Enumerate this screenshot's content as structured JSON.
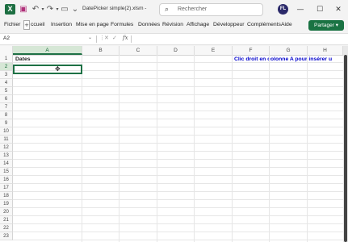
{
  "titlebar": {
    "logo_letter": "X",
    "file_title": "DatePicker simple(2).xlsm  -",
    "search_placeholder": "Rechercher",
    "avatar_initials": "FL",
    "minimize": "—",
    "maximize": "☐",
    "close": "✕"
  },
  "ribbon": {
    "tabs": [
      "Fichier",
      "ccueil",
      "Insertion",
      "Mise en page",
      "Formules",
      "Données",
      "Révision",
      "Affichage",
      "Développeur",
      "Compléments",
      "Aide"
    ],
    "home_box": "+",
    "share_label": "Partager ▾"
  },
  "formula_bar": {
    "name_box": "A2",
    "formula": ""
  },
  "grid": {
    "columns": [
      "A",
      "B",
      "C",
      "D",
      "E",
      "F",
      "G",
      "H"
    ],
    "rows": [
      "1",
      "2",
      "3",
      "4",
      "5",
      "6",
      "7",
      "8",
      "9",
      "10",
      "11",
      "12",
      "13",
      "14",
      "15",
      "16",
      "17",
      "18",
      "19",
      "20",
      "21",
      "22",
      "23"
    ],
    "selected_column": "A",
    "selected_row": "2",
    "cells": {
      "A1": "Dates",
      "F1": "Clic droit en colonne A pour insérer u"
    },
    "note_color": "#0000cc"
  }
}
